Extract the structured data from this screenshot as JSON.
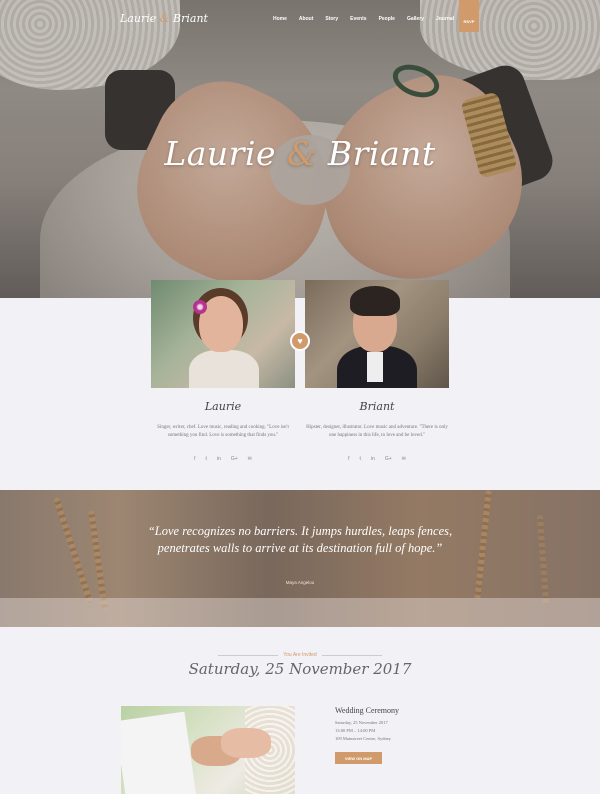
{
  "nav": {
    "logo_first": "Laurie",
    "logo_amp": "&",
    "logo_second": "Briant",
    "items": [
      "Home",
      "About",
      "Story",
      "Events",
      "People",
      "Gallery",
      "Journal"
    ],
    "rsvp_label": "RSVP"
  },
  "hero": {
    "title_first": "Laurie",
    "title_amp": "&",
    "title_second": "Briant"
  },
  "bride": {
    "name": "Laurie",
    "description": "Singer, writer, chef. Love music, reading and cooking. \"Love isn't something you find. Love is something that finds you.\"",
    "socials": [
      "f",
      "t",
      "in",
      "G+",
      "✉"
    ]
  },
  "groom": {
    "name": "Briant",
    "description": "Hipster, designer, illustrator. Love music and adventure. \"There is only one happiness in this life, to love and be loved.\"",
    "socials": [
      "f",
      "t",
      "in",
      "G+",
      "✉"
    ]
  },
  "quote": {
    "text": "“Love recognizes no barriers. It jumps hurdles, leaps fences, penetrates walls to arrive at its destination full of hope.”",
    "author": "Maya Angelou"
  },
  "invite": {
    "label": "You Are Invited",
    "date_script": "Saturday, 25 November 2017"
  },
  "event": {
    "title": "Wedding Ceremony",
    "date": "Saturday, 25 November 2017",
    "time": "13:00 PM – 14:00 PM",
    "place": "109 Mainstreet Centre, Sydney",
    "button_label": "VIEW ON MAP"
  },
  "colors": {
    "accent": "#d19a6a",
    "background": "#f1f1f6"
  }
}
